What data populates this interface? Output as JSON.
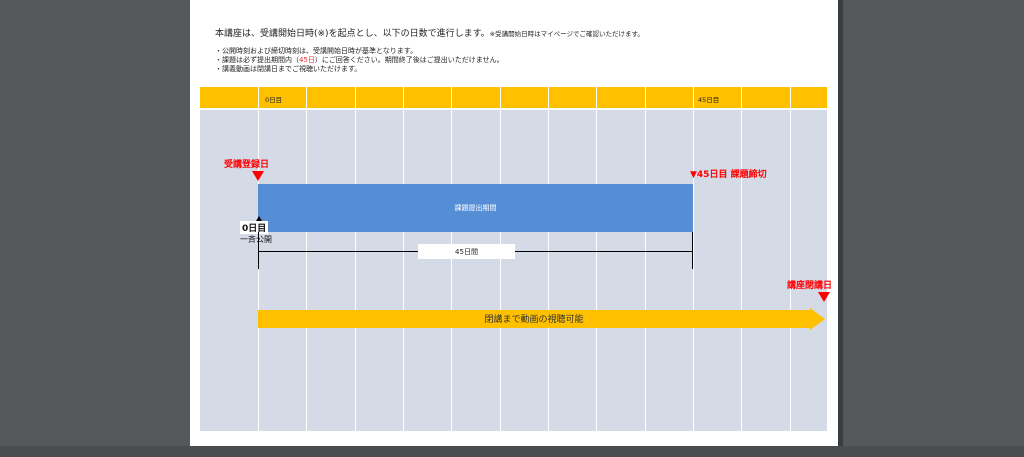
{
  "intro": {
    "main": "本講座は、受講開始日時(※)を起点とし、以下の日数で進行します。",
    "note": "※受講開始日時はマイページでご確認いただけます。"
  },
  "bullets": {
    "b1": "・公開時刻および締切時刻は、受講開始日時が基準となります。",
    "b2_pre": "・課題は必ず提出期間内（",
    "b2_red": "45日",
    "b2_post": "）にご回答ください。期間終了後はご提出いただけません。",
    "b3": "・講義動画は閉講日までご視聴いただけます。"
  },
  "timeline": {
    "header_labels": {
      "start": "0日目",
      "end": "45日目"
    },
    "start_marker": "受講登録日",
    "deadline_marker": "▼45日目 課題締切",
    "close_marker": "講座閉講日",
    "submission_period": "課題提出期間",
    "day0_label": "0日目",
    "day0_sub": "一斉公開",
    "span_label": "45日間",
    "video_label": "閉講まで動画の視聴可能"
  },
  "colors": {
    "header": "#ffc000",
    "body": "#d5dae7",
    "period": "#558ed5",
    "marker": "#ff0000",
    "arrow": "#ffc000"
  }
}
